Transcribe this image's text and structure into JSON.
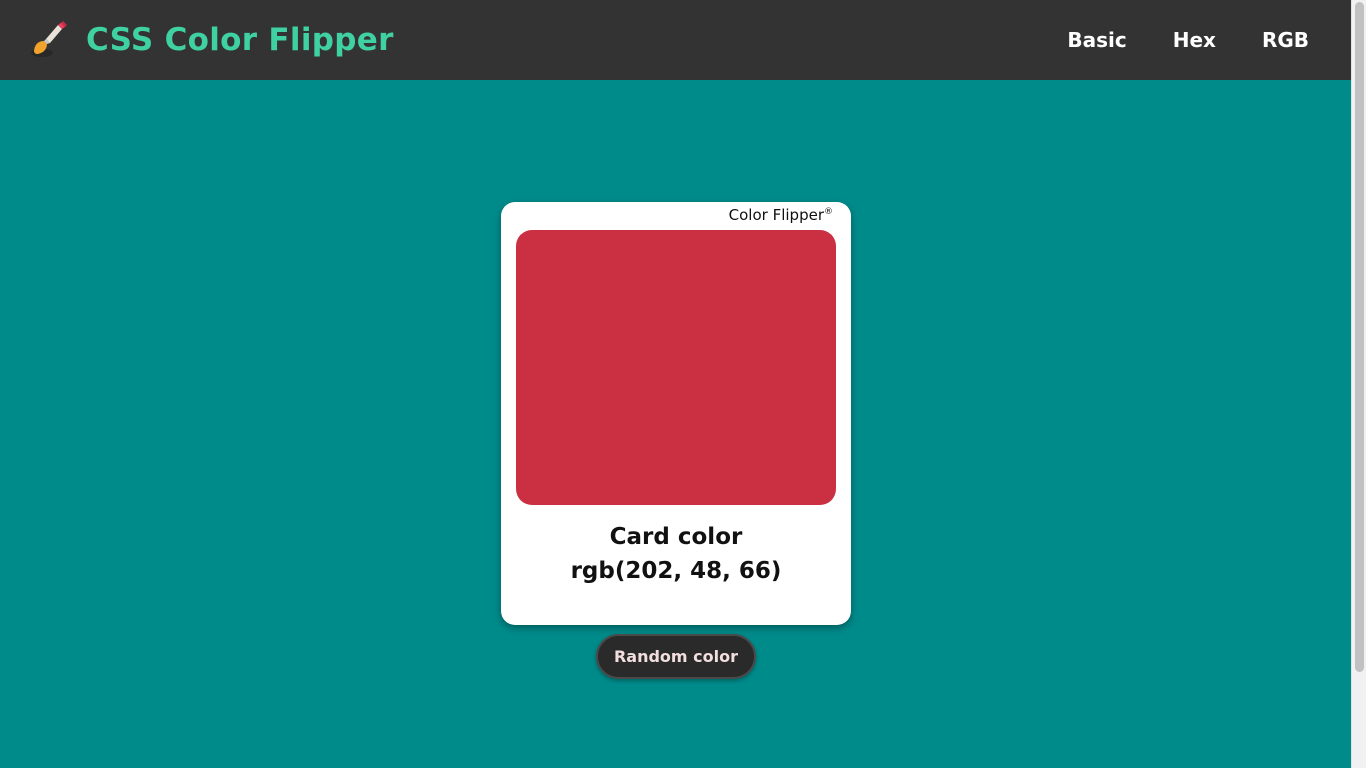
{
  "navbar": {
    "brand_icon": "paintbrush-icon",
    "title": "CSS Color Flipper",
    "links": [
      {
        "label": "Basic"
      },
      {
        "label": "Hex"
      },
      {
        "label": "RGB"
      }
    ]
  },
  "card": {
    "brand": "Color Flipper",
    "brand_mark": "®",
    "swatch_color": "#ca3042",
    "label_line1": "Card color",
    "label_line2": "rgb(202, 48, 66)"
  },
  "actions": {
    "random_label": "Random color"
  },
  "colors": {
    "background": "#008b8b",
    "navbar": "#333333",
    "brand_text": "#3fd1a1",
    "button": "#2a2a2a"
  }
}
